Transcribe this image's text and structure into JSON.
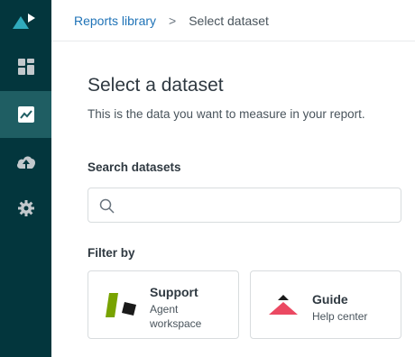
{
  "sidebar": {
    "logo_icon": "zendesk-explore-logo-icon",
    "items": [
      {
        "icon": "dashboard-icon",
        "active": false
      },
      {
        "icon": "reports-chart-icon",
        "active": true
      },
      {
        "icon": "cloud-upload-icon",
        "active": false
      },
      {
        "icon": "gear-icon",
        "active": false
      }
    ],
    "bg_color": "#03363d",
    "active_color": "#1f5e63"
  },
  "breadcrumb": {
    "link": "Reports library",
    "separator": ">",
    "current": "Select dataset"
  },
  "main": {
    "title": "Select a dataset",
    "subtitle": "This is the data you want to measure in your report.",
    "search_label": "Search datasets",
    "search_placeholder": "",
    "search_icon": "search-icon",
    "filter_label": "Filter by"
  },
  "filters": [
    {
      "title": "Support",
      "subtitle": "Agent workspace",
      "icon": "support-product-logo-icon",
      "color": "#78a300"
    },
    {
      "title": "Guide",
      "subtitle": "Help center",
      "icon": "guide-product-logo-icon",
      "color": "#eb4962"
    }
  ],
  "colors": {
    "link": "#1f73b7",
    "text": "#2f3941"
  }
}
